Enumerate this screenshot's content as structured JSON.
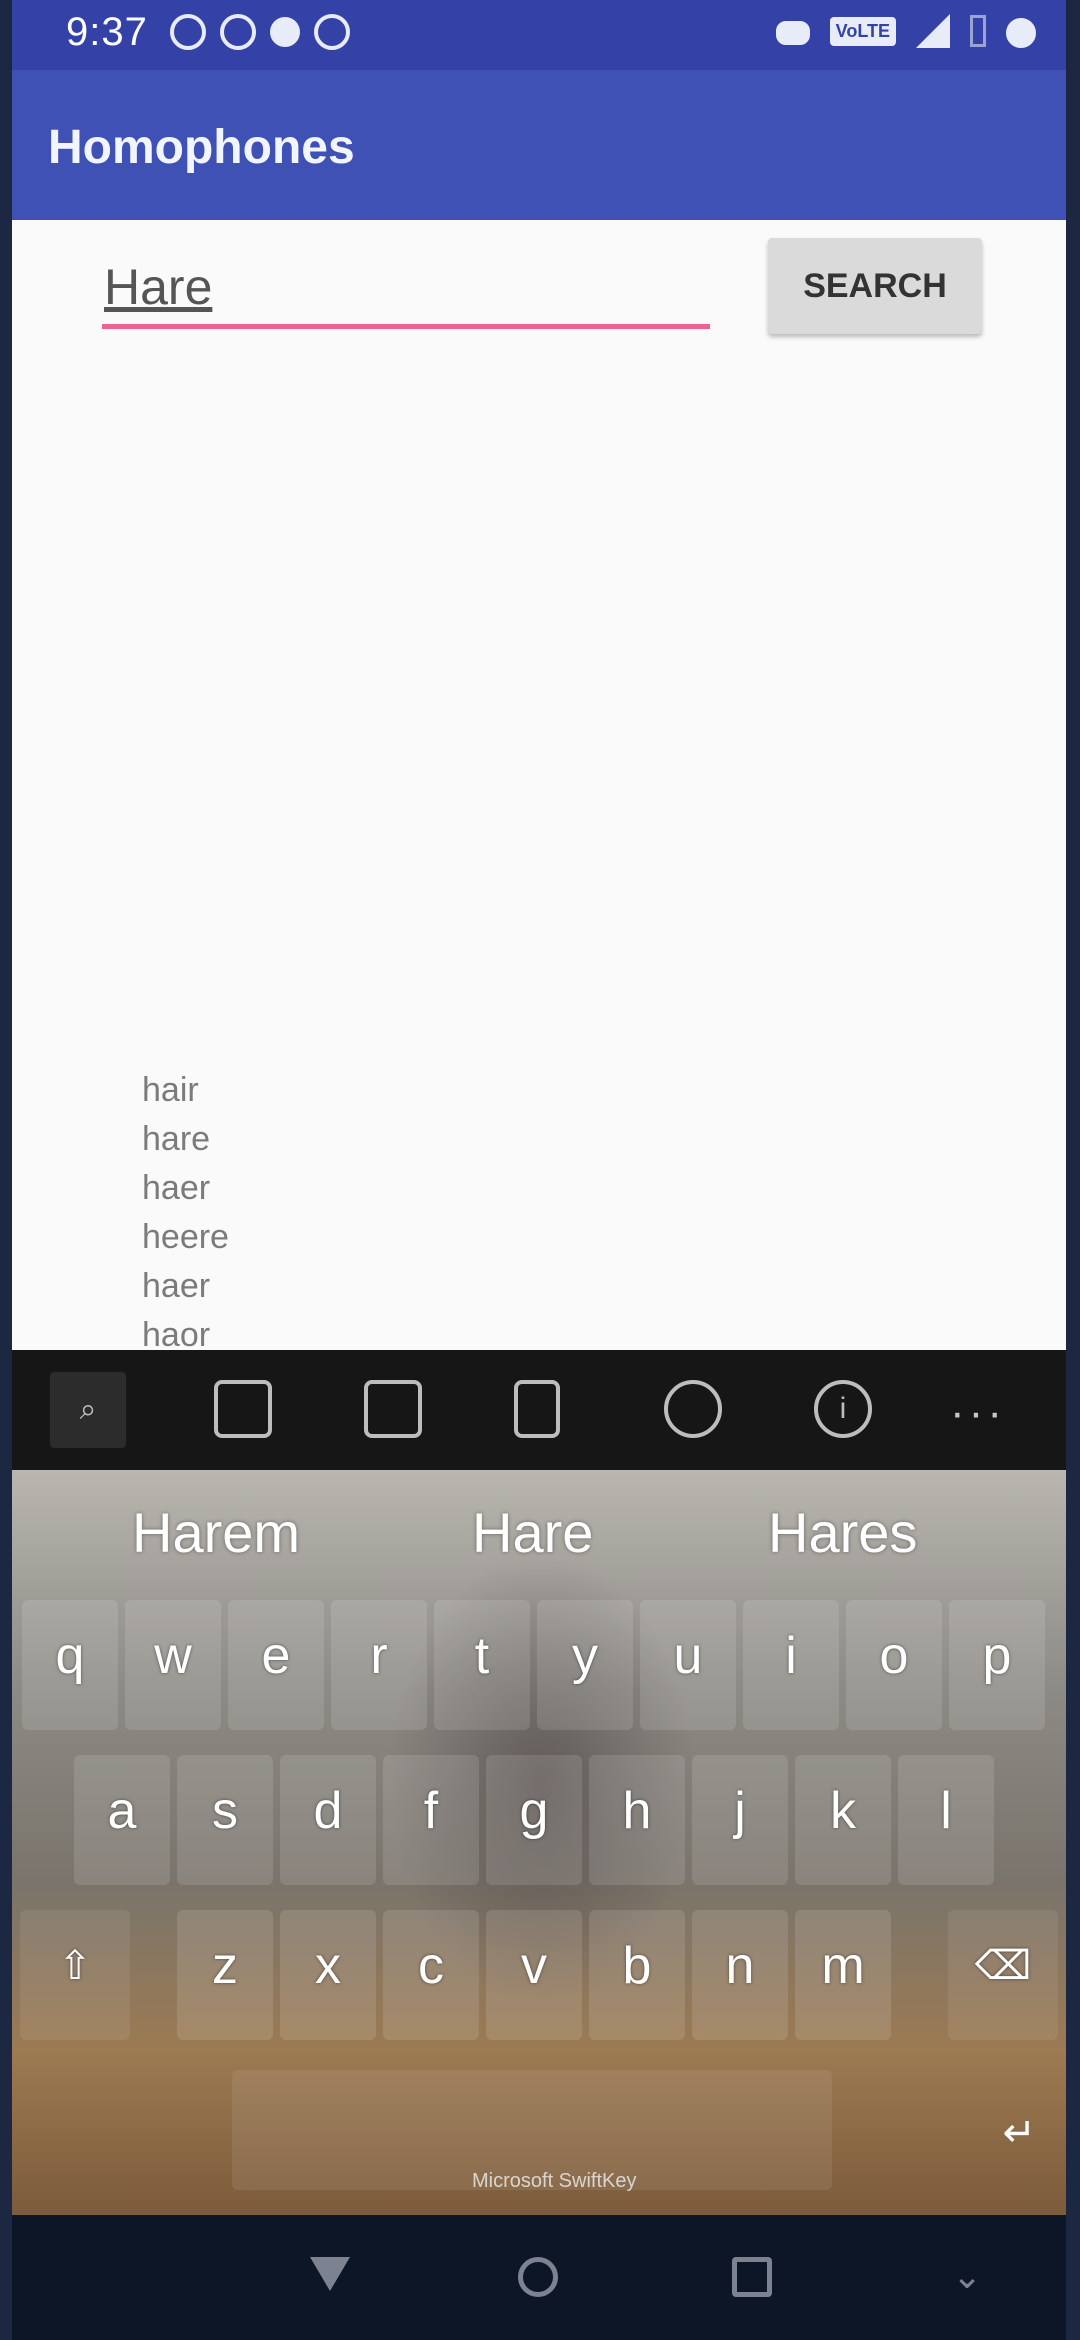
{
  "status_bar": {
    "time": "9:37",
    "left_icons": [
      "whatsapp-icon",
      "whatsapp-icon",
      "notification-dot-icon",
      "blocked-icon"
    ],
    "right_icons": [
      "gamepad-icon",
      "volte-icon",
      "signal-icon",
      "battery-icon",
      "data-saver-icon"
    ],
    "volte_label": "VoLTE"
  },
  "app_bar": {
    "title": "Homophones"
  },
  "search": {
    "value": "Hare",
    "button_label": "SEARCH"
  },
  "results": [
    "hair",
    "hare",
    "haer",
    "heere",
    "haer",
    "haor"
  ],
  "keyboard": {
    "toolbar_icons": [
      "search-icon",
      "gif-icon",
      "sticker-icon",
      "clipboard-icon",
      "theme-icon",
      "info-icon",
      "more-icon"
    ],
    "more_label": "···",
    "suggestions": [
      "Harem",
      "Hare",
      "Hares"
    ],
    "rows": [
      [
        "q",
        "w",
        "e",
        "r",
        "t",
        "y",
        "u",
        "i",
        "o",
        "p"
      ],
      [
        "a",
        "s",
        "d",
        "f",
        "g",
        "h",
        "j",
        "k",
        "l"
      ],
      [
        "z",
        "x",
        "c",
        "v",
        "b",
        "n",
        "m"
      ]
    ],
    "shift_label": "⇧",
    "backspace_label": "⌫",
    "space_label": "Microsoft SwiftKey",
    "enter_label": "↵"
  },
  "nav_bar": {
    "hide_label": "⌄"
  }
}
